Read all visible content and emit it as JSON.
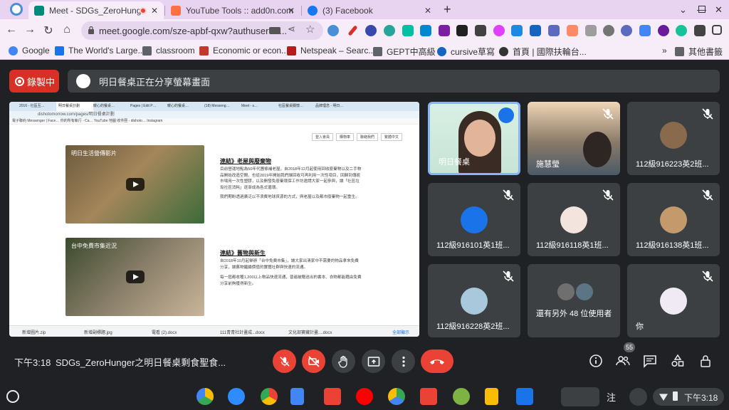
{
  "browser": {
    "tabs": [
      {
        "title": "Meet - SDGs_ZeroHunger之明日",
        "active": true,
        "favicon_color": "#00897b"
      },
      {
        "title": "YouTube Tools :: add0n.com",
        "active": false,
        "favicon_color": "#ff7043"
      },
      {
        "title": "(3) Facebook",
        "active": false,
        "favicon_color": "#1877f2"
      }
    ],
    "new_tab": "+",
    "close": "✕",
    "url": "meet.google.com/sze-apbf-qxw?authuser=0...",
    "bookmarks": [
      {
        "label": "Google",
        "color": "#4285f4"
      },
      {
        "label": "The World's Large...",
        "color": "#1a73e8"
      },
      {
        "label": "classroom",
        "color": "#5f6368"
      },
      {
        "label": "Economic or econ...",
        "color": "#c0392b"
      },
      {
        "label": "Netspeak – Searc...",
        "color": "#b71c1c"
      },
      {
        "label": "GEPT中高級",
        "color": "#5f6368"
      },
      {
        "label": "cursive草寫",
        "color": "#1565c0"
      },
      {
        "label": "首頁 | 國際扶輪台...",
        "color": "#333333"
      }
    ],
    "bookmarks_more": "»",
    "other_bookmarks": "其他書籤"
  },
  "meet": {
    "recording_label": "錄製中",
    "presenting_banner": "明日餐桌正在分享螢幕畫面",
    "shared_screen": {
      "tabs": [
        "2016 - 社區互…",
        "明日餐桌計劃",
        "暖心的餐桌…",
        "Pages | Edit P…",
        "暖心的餐桌…",
        "(18) Messeng…",
        "Meet - s…",
        "社區餐桌關懷…",
        "品牌理念 - 明日…"
      ],
      "url": "dishotomorrow.com/pages/明日餐桌計劃",
      "bookmarks": "電子聯約  Messenger | Face…  你的所有執行 - Ca…  YouTube  地圖  收件匣 - dishoto…  Instagram",
      "page_buttons": [
        "登入會員",
        "購物車",
        "聯絡我們",
        "繁體中文"
      ],
      "video1_caption": "明日生活營傳影片",
      "video2_caption": "台中免費市集近況",
      "article1_title": "連結》老屋與廢棄物",
      "article1_p1": "目前營運地點為50年代團條補老屋，自2018年12月起使用回收廢棄物以及二手物品開始改造空間，也從2019年開始我們讓回收可再利用一次性項目，回歸到傳統市場用一次性塑膠，以及開發免廢棄環保工作坊邀請大家一起參與，讓「社區垃圾社區消耗」逐漸成為各式循環。",
      "article1_p2": "我們期盼透過廣泛以不浪費地球資源的方式，與老屋以及都市廢棄物一起重生。",
      "article2_title": "連結》舊物與新生",
      "article2_p1": "自2018年10月起舉辦「台中免費市集」，讓大家出清家中不需要的物品拿來免費分享，讓舊物繼續價值的實體社群與快速的流通。",
      "article2_p2": "每一屆都收穫1,200以上物品快速流通，普遍被贈送出的書本、衣物都能藉由免費分享前夠獲得新生。",
      "downloads": [
        "新增圖片.zip",
        "新增副標題.jpg",
        "電看 (2).docx",
        "111青青社計畫成...docx",
        "文化部寶藏計畫....docx"
      ],
      "downloads_all": "全部顯示"
    },
    "participants": [
      {
        "name": "明日餐桌",
        "speaking": true
      },
      {
        "name": "施慧瑩",
        "muted": true
      },
      {
        "name": "112級916223英2班...",
        "muted": true
      },
      {
        "name": "112級916101英1班...",
        "muted": true
      },
      {
        "name": "112級916118英1班...",
        "muted": true
      },
      {
        "name": "112級916138英1班...",
        "muted": true
      },
      {
        "name": "112級916228英2班...",
        "muted": true
      },
      {
        "name": "還有另外 48 位使用者"
      },
      {
        "name": "你",
        "muted": true
      }
    ],
    "time": "下午3:18",
    "meeting_title": "SDGs_ZeroHunger之明日餐桌剩食聖食...",
    "people_count": "55"
  },
  "shelf": {
    "ime": "注",
    "time": "下午3:18"
  },
  "colors": {
    "meet_bg": "#202124",
    "tile_bg": "#3c4043",
    "red": "#ea4335",
    "recording": "#d93025",
    "active_speaker": "#8ab4f8",
    "tabstrip": "#e8d3f0"
  }
}
